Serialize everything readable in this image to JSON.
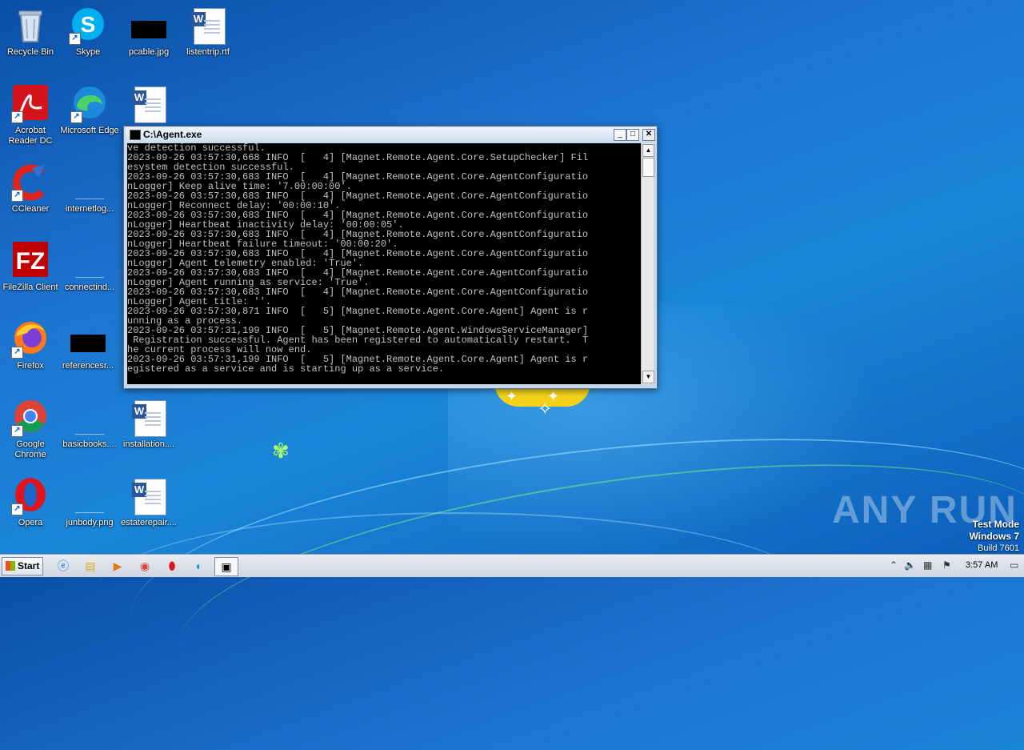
{
  "desktop": {
    "icons": [
      {
        "label": "Recycle Bin",
        "icon": "recycle-bin-icon"
      },
      {
        "label": "Skype",
        "icon": "skype-icon"
      },
      {
        "label": "pcable.jpg",
        "icon": "image-file-icon"
      },
      {
        "label": "listentrip.rtf",
        "icon": "word-document-icon"
      },
      {
        "label": "Acrobat Reader DC",
        "icon": "acrobat-icon"
      },
      {
        "label": "Microsoft Edge",
        "icon": "edge-icon"
      },
      {
        "label": "",
        "icon": "word-document-icon"
      },
      {
        "label": "CCleaner",
        "icon": "ccleaner-icon"
      },
      {
        "label": "internetlog...",
        "icon": "file-icon"
      },
      {
        "label": "FileZilla Client",
        "icon": "filezilla-icon"
      },
      {
        "label": "connectind...",
        "icon": "file-icon"
      },
      {
        "label": "Firefox",
        "icon": "firefox-icon"
      },
      {
        "label": "referencesr...",
        "icon": "image-file-icon"
      },
      {
        "label": "Google Chrome",
        "icon": "chrome-icon"
      },
      {
        "label": "basicbooks....",
        "icon": "file-icon"
      },
      {
        "label": "installation....",
        "icon": "word-document-icon"
      },
      {
        "label": "Opera",
        "icon": "opera-icon"
      },
      {
        "label": "junbody.png",
        "icon": "file-icon"
      },
      {
        "label": "estaterepair....",
        "icon": "word-document-icon"
      }
    ]
  },
  "console": {
    "title": "C:\\Agent.exe",
    "lines": [
      "ve detection successful.",
      "2023-09-26 03:57:30,668 INFO  [   4] [Magnet.Remote.Agent.Core.SetupChecker] Fil",
      "esystem detection successful.",
      "2023-09-26 03:57:30,683 INFO  [   4] [Magnet.Remote.Agent.Core.AgentConfiguratio",
      "nLogger] Keep alive time: '7.00:00:00'.",
      "2023-09-26 03:57:30,683 INFO  [   4] [Magnet.Remote.Agent.Core.AgentConfiguratio",
      "nLogger] Reconnect delay: '00:00:10'.",
      "2023-09-26 03:57:30,683 INFO  [   4] [Magnet.Remote.Agent.Core.AgentConfiguratio",
      "nLogger] Heartbeat inactivity delay: '00:00:05'.",
      "2023-09-26 03:57:30,683 INFO  [   4] [Magnet.Remote.Agent.Core.AgentConfiguratio",
      "nLogger] Heartbeat failure timeout: '00:00:20'.",
      "2023-09-26 03:57:30,683 INFO  [   4] [Magnet.Remote.Agent.Core.AgentConfiguratio",
      "nLogger] Agent telemetry enabled: 'True'.",
      "2023-09-26 03:57:30,683 INFO  [   4] [Magnet.Remote.Agent.Core.AgentConfiguratio",
      "nLogger] Agent running as service: 'True'.",
      "2023-09-26 03:57:30,683 INFO  [   4] [Magnet.Remote.Agent.Core.AgentConfiguratio",
      "nLogger] Agent title: ''.",
      "2023-09-26 03:57:30,871 INFO  [   5] [Magnet.Remote.Agent.Core.Agent] Agent is r",
      "unning as a process.",
      "2023-09-26 03:57:31,199 INFO  [   5] [Magnet.Remote.Agent.WindowsServiceManager]",
      " Registration successful. Agent has been registered to automatically restart.  T",
      "he current process will now end.",
      "2023-09-26 03:57:31,199 INFO  [   5] [Magnet.Remote.Agent.Core.Agent] Agent is r",
      "egistered as a service and is starting up as a service."
    ]
  },
  "watermark": {
    "brand": "ANY RUN",
    "test_mode": "Test Mode",
    "os": "Windows 7",
    "build": "Build 7601"
  },
  "taskbar": {
    "start_label": "Start",
    "items": [
      "internet-explorer-icon",
      "explorer-icon",
      "media-player-icon",
      "chrome-icon",
      "opera-icon",
      "edge-icon",
      "console-icon"
    ],
    "clock": "3:57 AM"
  }
}
